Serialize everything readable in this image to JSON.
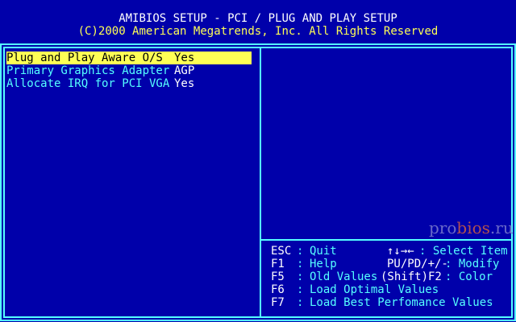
{
  "header": {
    "title": "AMIBIOS SETUP - PCI / PLUG AND PLAY SETUP",
    "copyright": "(C)2000 American Megatrends, Inc. All Rights Reserved"
  },
  "options": [
    {
      "label": "Plug and Play Aware O/S",
      "value": "Yes",
      "selected": true
    },
    {
      "label": "Primary Graphics Adapter",
      "value": "AGP",
      "selected": false
    },
    {
      "label": "Allocate IRQ for PCI VGA",
      "value": "Yes",
      "selected": false
    }
  ],
  "help": {
    "rows": [
      {
        "key": "ESC",
        "desc": "Quit",
        "key2": "↑↓→←",
        "desc2": ": Select Item"
      },
      {
        "key": "F1",
        "desc": "Help",
        "key2": "PU/PD/+/-",
        "desc2": ": Modify"
      },
      {
        "key": "F5",
        "desc": "Old Values",
        "key2": "(Shift)F2",
        "desc2": ": Color"
      },
      {
        "key": "F6",
        "desc": "Load Optimal Values",
        "key2": "",
        "desc2": ""
      },
      {
        "key": "F7",
        "desc": "Load Best Perfomance Values",
        "key2": "",
        "desc2": ""
      }
    ],
    "separator": ":"
  },
  "watermark": {
    "prefix": "pro",
    "accent": "bios",
    "suffix": ".ru"
  },
  "colors": {
    "background": "#0000aa",
    "frame": "#55ffff",
    "highlight": "#ffff55",
    "title": "#ffffff",
    "copyright": "#ffff55"
  }
}
